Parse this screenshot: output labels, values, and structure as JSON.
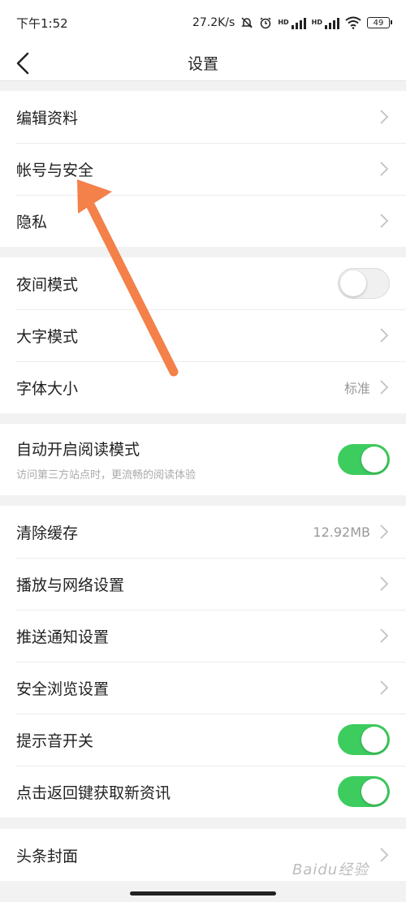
{
  "status_bar": {
    "time": "下午1:52",
    "net_speed": "27.2K/s",
    "hd1": "HD",
    "hd2": "HD",
    "battery": "49",
    "icons": [
      "mute-bell-icon",
      "alarm-icon",
      "signal-icon",
      "signal-icon",
      "wifi-icon",
      "battery-icon"
    ]
  },
  "nav": {
    "title": "设置",
    "back_icon": "chevron-left-icon"
  },
  "groups": {
    "g1": [
      {
        "label": "编辑资料"
      },
      {
        "label": "帐号与安全"
      },
      {
        "label": "隐私"
      }
    ],
    "g2": [
      {
        "label": "夜间模式",
        "toggle": "off"
      },
      {
        "label": "大字模式"
      },
      {
        "label": "字体大小",
        "value": "标准"
      }
    ],
    "g3": [
      {
        "label": "自动开启阅读模式",
        "sub": "访问第三方站点时，更流畅的阅读体验",
        "toggle": "on"
      }
    ],
    "g4": [
      {
        "label": "清除缓存",
        "value": "12.92MB"
      },
      {
        "label": "播放与网络设置"
      },
      {
        "label": "推送通知设置"
      },
      {
        "label": "安全浏览设置"
      },
      {
        "label": "提示音开关",
        "toggle": "on"
      },
      {
        "label": "点击返回键获取新资讯",
        "toggle": "on"
      }
    ],
    "g5": [
      {
        "label": "头条封面"
      }
    ]
  },
  "watermark": "Baidu经验",
  "colors": {
    "toggle_on": "#3dcc5e",
    "annotation_arrow": "#f4804a",
    "background": "#f2f2f2"
  }
}
